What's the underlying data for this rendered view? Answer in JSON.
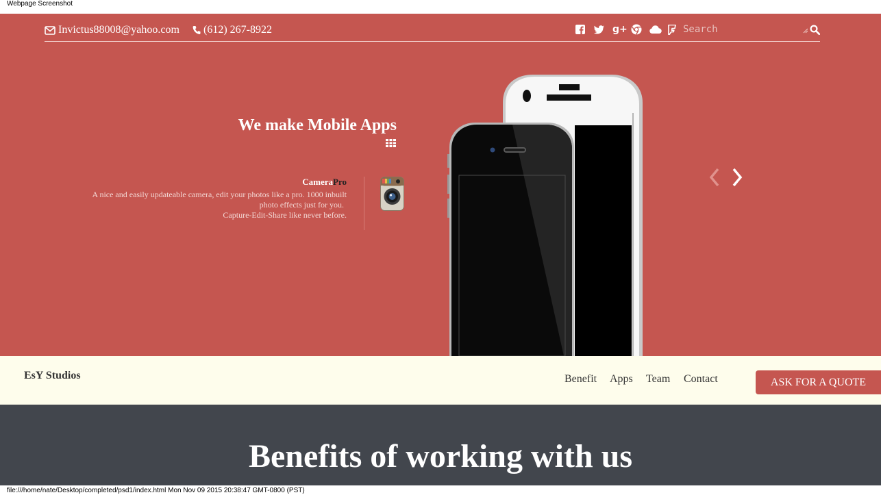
{
  "capture": {
    "title": "Webpage Screenshot",
    "footer": "file:///home/nate/Desktop/completed/psd1/index.html Mon Nov 09 2015 20:38:47 GMT-0800 (PST)"
  },
  "topbar": {
    "email": "Invictus88008@yahoo.com",
    "phone": "(612) 267-8922",
    "social_icons": [
      "facebook-icon",
      "twitter-icon",
      "google-plus-icon",
      "chrome-icon",
      "cloud-icon",
      "foursquare-icon"
    ],
    "search_placeholder": "Search"
  },
  "hero": {
    "headline": "We make Mobile Apps",
    "app": {
      "name_part1": "Camera",
      "name_part2": "Pro",
      "desc_line1": "A nice and easily updateable camera, edit your photos like a pro. 1000 inbuilt",
      "desc_line2": "photo effects just for you.",
      "desc_line3": "Capture-Edit-Share like never before."
    }
  },
  "navbar": {
    "brand": "EsY Studios",
    "links": [
      "Benefit",
      "Apps",
      "Team",
      "Contact"
    ],
    "cta": "ASK FOR A QUOTE"
  },
  "benefits": {
    "title": "Benefits of working with us"
  },
  "colors": {
    "hero_bg": "#c55650",
    "navbar_bg": "#fefdec",
    "section_bg": "#42464d"
  }
}
